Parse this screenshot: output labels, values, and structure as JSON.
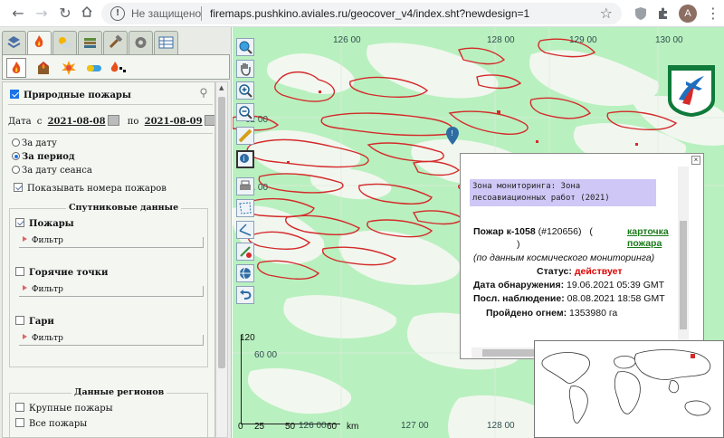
{
  "browser": {
    "security_label": "Не защищено",
    "url": "firemaps.pushkino.aviales.ru/geocover_v4/index.sht?newdesign=1",
    "avatar_letter": "A"
  },
  "panel": {
    "tabs": [
      "layers-tab",
      "fire-tab",
      "weather-tab",
      "stack-tab",
      "tools-tab",
      "settings-tab",
      "table-tab"
    ],
    "natural_fires_label": "Природные пожары",
    "date_label": "Дата",
    "from_label": "с",
    "date_from": "2021-08-08",
    "to_label": "по",
    "date_to": "2021-08-09",
    "radio_by_date": "За дату",
    "radio_by_period": "За период",
    "radio_by_session": "За дату сеанса",
    "show_numbers_label": "Показывать номера пожаров",
    "satellite_section": "Спутниковые данные",
    "fires_label": "Пожары",
    "hotspots_label": "Горячие точки",
    "burns_label": "Гари",
    "filter_label": "Фильтр",
    "regions_section": "Данные регионов",
    "large_fires_label": "Крупные пожары",
    "all_fires_label": "Все пожары"
  },
  "map": {
    "top_coords": [
      "126 00",
      "128 00",
      "129 00",
      "130 00"
    ],
    "bottom_coords": [
      "126 00",
      "127 00",
      "128 00"
    ],
    "left_coords": [
      "62 00",
      "61 00",
      "60 00"
    ],
    "scale_km": "km",
    "scale_ticks": [
      "0",
      "25",
      "50",
      "60"
    ],
    "scale_vert": "120"
  },
  "popup": {
    "zone_text": "Зона мониторинга: Зона лесоавиационных работ (2021)",
    "fire_id_label": "Пожар к-1058",
    "fire_num": "(#120656)",
    "card_open": "(",
    "card_link": "карточка пожара",
    "card_close": ")",
    "source_note": "(по данным космического мониторинга)",
    "status_label": "Статус:",
    "status_value": "действует",
    "detected_label": "Дата обнаружения:",
    "detected_value": "19.06.2021 05:39 GMT",
    "last_obs_label": "Посл. наблюдение:",
    "last_obs_value": "08.08.2021 18:58 GMT",
    "burned_label": "Пройдено огнем:",
    "burned_value": "1353980 га"
  },
  "colors": {
    "fire_outline": "#d42a2a",
    "map_green": "#b9f0bf",
    "zone_highlight": "#cfc7f6",
    "status_red": "#e00000"
  }
}
